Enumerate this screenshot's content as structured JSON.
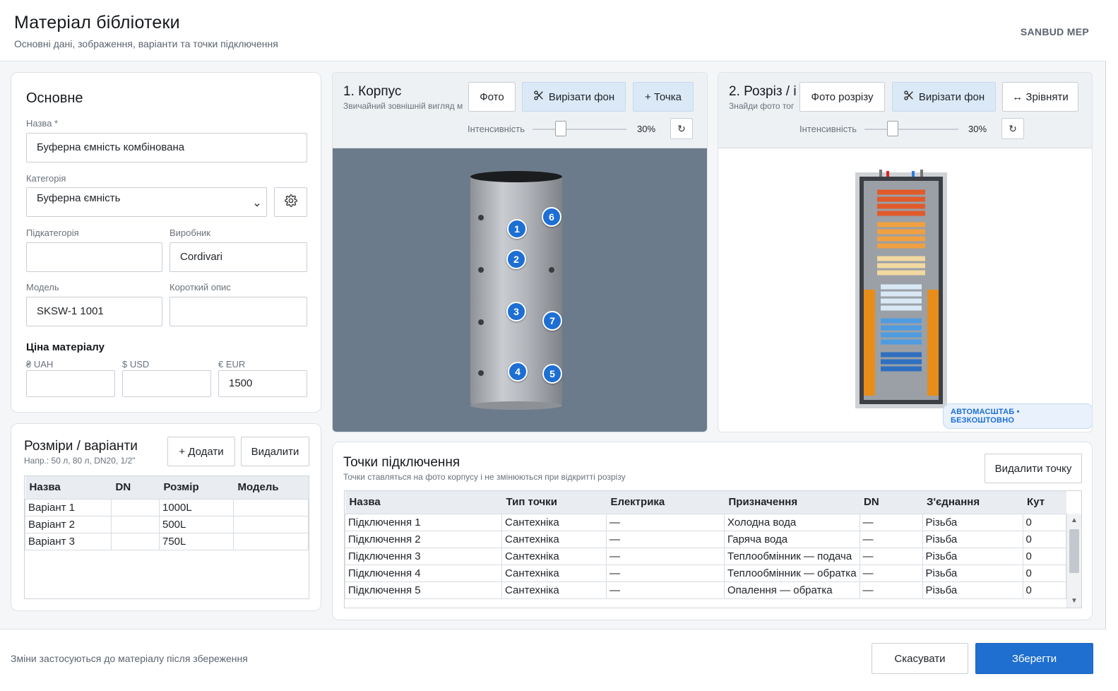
{
  "header": {
    "title": "Матеріал бібліотеки",
    "subtitle": "Основні дані, зображення, варіанти та точки підключення",
    "brand": "SANBUD MEP"
  },
  "basic": {
    "section_title": "Основне",
    "name_label": "Назва *",
    "name_value": "Буферна ємність комбінована",
    "category_label": "Категорія",
    "category_value": "Буферна ємність",
    "subcategory_label": "Підкатегорія",
    "subcategory_value": "",
    "manufacturer_label": "Виробник",
    "manufacturer_value": "Cordivari",
    "model_label": "Модель",
    "model_value": "SKSW-1 1001",
    "short_desc_label": "Короткий опис",
    "short_desc_value": "",
    "price_title": "Ціна матеріалу",
    "uah_label": "₴ UAH",
    "uah_value": "",
    "usd_label": "$ USD",
    "usd_value": "",
    "eur_label": "€ EUR",
    "eur_value": "1500"
  },
  "variants": {
    "title": "Розміри / варіанти",
    "hint": "Напр.: 50 л, 80 л, DN20, 1/2\"",
    "add_label": "+ Додати",
    "delete_label": "Видалити",
    "columns": [
      "Назва",
      "DN",
      "Розмір",
      "Модель"
    ],
    "rows": [
      [
        "Варіант 1",
        "",
        "1000L",
        ""
      ],
      [
        "Варіант 2",
        "",
        "500L",
        ""
      ],
      [
        "Варіант 3",
        "",
        "750L",
        ""
      ]
    ]
  },
  "body_panel": {
    "title": "1. Корпус",
    "subtitle": "Звичайний зовнішній вигляд м",
    "photo_label": "Фото",
    "cut_bg_label": "Вирізати фон",
    "add_point_label": "+ Точка",
    "intensity_label": "Інтенсивність",
    "intensity_value": "30%",
    "intensity_fraction": 0.3,
    "markers": [
      "1",
      "2",
      "3",
      "4",
      "5",
      "6",
      "7"
    ]
  },
  "section_panel": {
    "title": "2. Розріз / і",
    "subtitle": "Знайди фото тог",
    "photo_label": "Фото розрізу",
    "cut_bg_label": "Вирізати фон",
    "align_label": "↔ Зрівняти",
    "intensity_label": "Інтенсивність",
    "intensity_value": "30%",
    "intensity_fraction": 0.3,
    "badge": "АВТОМАСШТАБ • БЕЗКОШТОВНО"
  },
  "points": {
    "title": "Точки підключення",
    "hint": "Точки ставляться на фото корпусу і не змінюються при відкритті розрізу",
    "delete_label": "Видалити точку",
    "columns": [
      "Назва",
      "Тип точки",
      "Електрика",
      "Призначення",
      "DN",
      "З'єднання",
      "Кут"
    ],
    "rows": [
      [
        "Підключення 1",
        "Сантехніка",
        "—",
        "Холодна вода",
        "—",
        "Різьба",
        "0"
      ],
      [
        "Підключення 2",
        "Сантехніка",
        "—",
        "Гаряча вода",
        "—",
        "Різьба",
        "0"
      ],
      [
        "Підключення 3",
        "Сантехніка",
        "—",
        "Теплообмінник — подача",
        "—",
        "Різьба",
        "0"
      ],
      [
        "Підключення 4",
        "Сантехніка",
        "—",
        "Теплообмінник — обратка",
        "—",
        "Різьба",
        "0"
      ],
      [
        "Підключення 5",
        "Сантехніка",
        "—",
        "Опалення — обратка",
        "—",
        "Різьба",
        "0"
      ]
    ]
  },
  "footer": {
    "note": "Зміни застосуються до матеріалу після збереження",
    "cancel_label": "Скасувати",
    "save_label": "Зберегти"
  },
  "colors": {
    "accent": "#1e6fd0",
    "marker": "#1d6fd3",
    "canvas_bg": "#6c7b8b"
  }
}
